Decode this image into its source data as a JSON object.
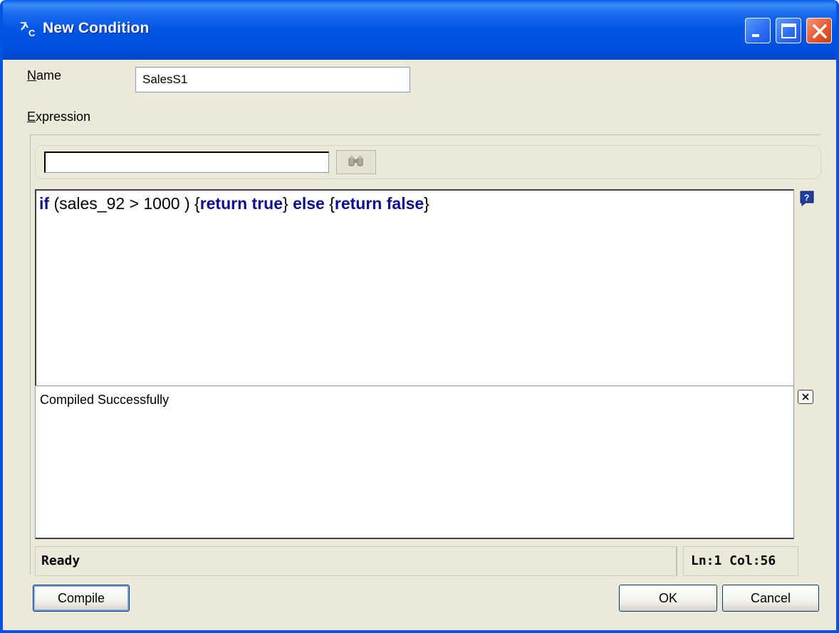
{
  "window": {
    "title": "New Condition",
    "title_icon": "condition-icon",
    "controls": [
      "minimize-icon",
      "maximize-icon",
      "close-icon"
    ]
  },
  "form": {
    "name_label_mnemonic": "N",
    "name_label_rest": "ame",
    "name_value": "SalesS1",
    "expression_label_mnemonic": "E",
    "expression_label_rest": "xpression"
  },
  "search": {
    "value": "",
    "find_icon": "binoculars-icon"
  },
  "editor": {
    "tokens": [
      {
        "text": "if",
        "keyword": true
      },
      {
        "text": " (sales_92 > 1000 ) {",
        "keyword": false
      },
      {
        "text": "return true",
        "keyword": true
      },
      {
        "text": "} ",
        "keyword": false
      },
      {
        "text": "else",
        "keyword": true
      },
      {
        "text": " {",
        "keyword": false
      },
      {
        "text": "return false",
        "keyword": true
      },
      {
        "text": "}",
        "keyword": false
      }
    ],
    "help_icon": "help-icon"
  },
  "output": {
    "message": "Compiled Successfully",
    "close_icon": "close-output-icon"
  },
  "status": {
    "text": "Ready",
    "position": "Ln:1 Col:56"
  },
  "buttons": {
    "compile": "Compile",
    "ok": "OK",
    "cancel": "Cancel"
  },
  "colors": {
    "titlebar": "#0055e5",
    "keyword": "#0d0d8c",
    "dialog_bg": "#ece9d8",
    "close_button": "#e2562c"
  }
}
